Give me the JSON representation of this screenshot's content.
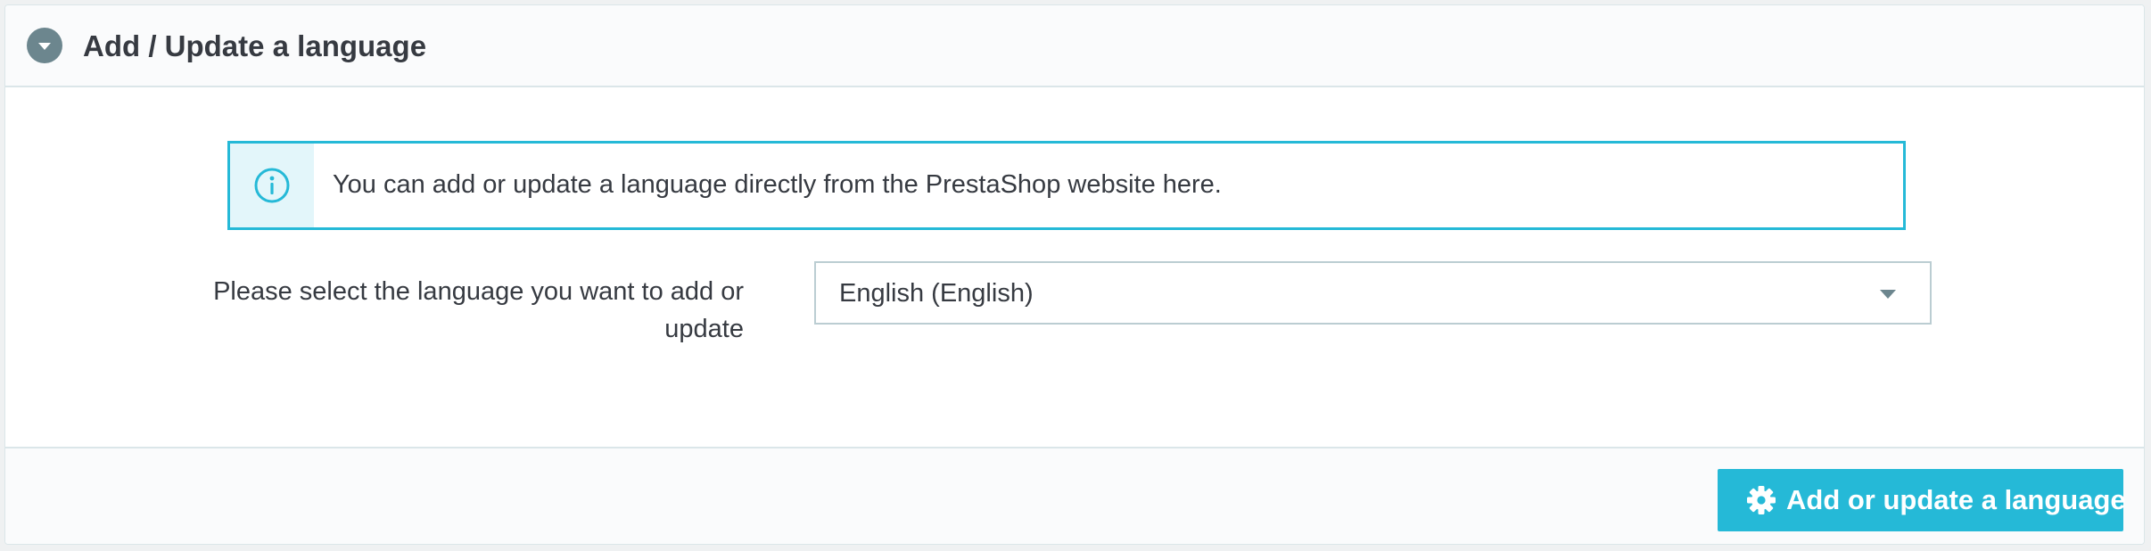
{
  "panel": {
    "title": "Add / Update a language",
    "toggle_icon": "chevron-down-icon"
  },
  "alert": {
    "icon": "info-icon",
    "message": "You can add or update a language directly from the PrestaShop website here."
  },
  "form": {
    "language_label": "Please select the language you want to add or update",
    "language_select": {
      "selected": "English (English)",
      "caret_icon": "caret-down-icon"
    }
  },
  "footer": {
    "submit_button": {
      "label": "Add or update a language",
      "icon": "gear-icon"
    }
  },
  "colors": {
    "accent": "#25b9d7",
    "alert_icon_bg": "#e3f6fa",
    "toggle_bg": "#6c868e",
    "text": "#363a41",
    "border": "#dbe6e9"
  }
}
